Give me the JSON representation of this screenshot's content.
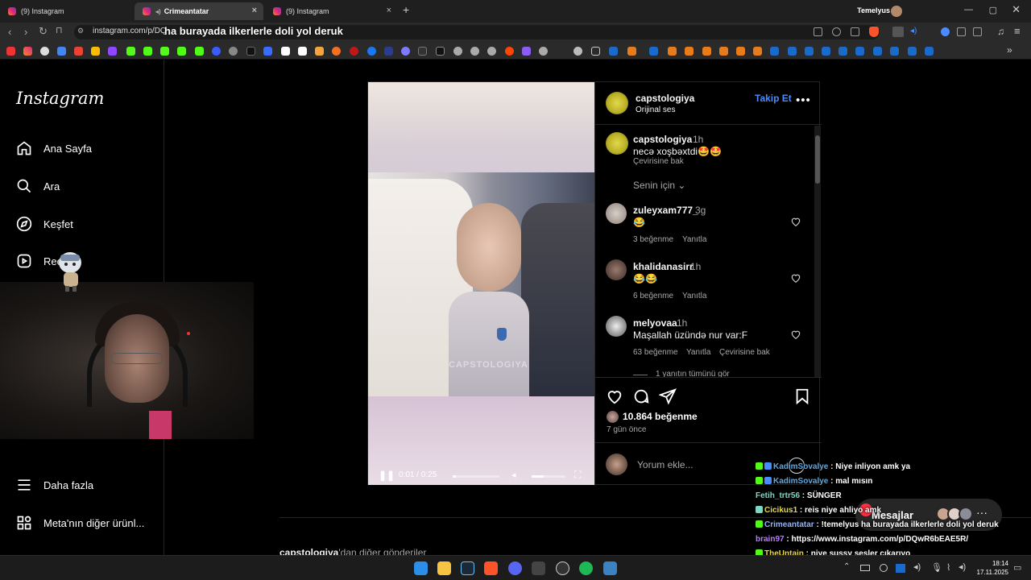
{
  "browser": {
    "tabs": [
      {
        "title": "(9) Instagram",
        "active": false
      },
      {
        "title": "Crimeantatar",
        "active": true
      },
      {
        "title": "(9) Instagram",
        "active": false
      }
    ],
    "profile_name": "Temelyus",
    "url": "instagram.com/p/DQ",
    "overlay_text": "ha burayada ilkerlerle doli yol deruk"
  },
  "sidebar": {
    "logo": "Instagram",
    "items": [
      {
        "label": "Ana Sayfa",
        "icon": "home-icon"
      },
      {
        "label": "Ara",
        "icon": "search-icon"
      },
      {
        "label": "Keşfet",
        "icon": "compass-icon"
      },
      {
        "label": "Reels",
        "icon": "reels-icon"
      },
      {
        "label": "Daha fazla",
        "icon": "menu-icon"
      },
      {
        "label": "Meta'nın diğer ürünl...",
        "icon": "grid-icon"
      }
    ]
  },
  "post": {
    "author": "capstologiya",
    "audio": "Orijinal ses",
    "follow_label": "Takip Et",
    "caption_author": "capstologiya",
    "caption_time": "1h",
    "caption_text": "necə xoşbəxtdi🤩🤩",
    "see_translation": "Çevirisine bak",
    "sort_label": "Senin için",
    "comments": [
      {
        "user": "zuleyxam777_",
        "time": "3g",
        "text": "😂",
        "likes": "3 beğenme",
        "reply": "Yanıtla",
        "translate": ""
      },
      {
        "user": "khalidanasirr",
        "time": "1h",
        "text": "😂😂",
        "likes": "6 beğenme",
        "reply": "Yanıtla",
        "translate": ""
      },
      {
        "user": "melyovaa",
        "time": "1h",
        "text": "Maşallah üzündə nur var:F",
        "likes": "63 beğenme",
        "reply": "Yanıtla",
        "translate": "Çevirisine bak"
      }
    ],
    "view_replies": "1 yanıtın tümünü gör",
    "likes_count": "10.864 beğenme",
    "posted_ago": "7 gün önce",
    "comment_placeholder": "Yorum ekle...",
    "video_time": "0:01 / 0:25",
    "watermark": "CAPSTOLOGIYA"
  },
  "more_from": {
    "user": "capstologiya",
    "suffix": "'dan diğer gönderiler"
  },
  "messages_label": "Mesajlar",
  "chat": [
    {
      "user": "KadimSovalye",
      "msg": " : Niye inliyon amk ya",
      "color": "#5aa9e6"
    },
    {
      "user": "KadimSovalye",
      "msg": " : mal mısın",
      "color": "#5aa9e6"
    },
    {
      "user": "Fetih_trtr56",
      "msg": " : SÜNGER",
      "color": "#7fd6c2"
    },
    {
      "user": "Cicikus1",
      "msg": " : reis niye ahliyo amk",
      "color": "#e9d74a"
    },
    {
      "user": "Crimeantatar",
      "msg": " : !temelyus ha burayada ilkerlerle doli yol deruk",
      "color": "#8ab4ff"
    },
    {
      "user": "brain97",
      "msg": " : https://www.instagram.com/p/DQwR6bEAE5R/",
      "color": "#b77cff"
    },
    {
      "user": "TheUntain",
      "msg": " : niye sussy sesler çıkarıyo",
      "color": "#e9d74a"
    }
  ],
  "clock": {
    "time": "18:14",
    "date": "17.11.2025"
  },
  "colors": {
    "accent": "#4a8cff",
    "background": "#000000"
  }
}
